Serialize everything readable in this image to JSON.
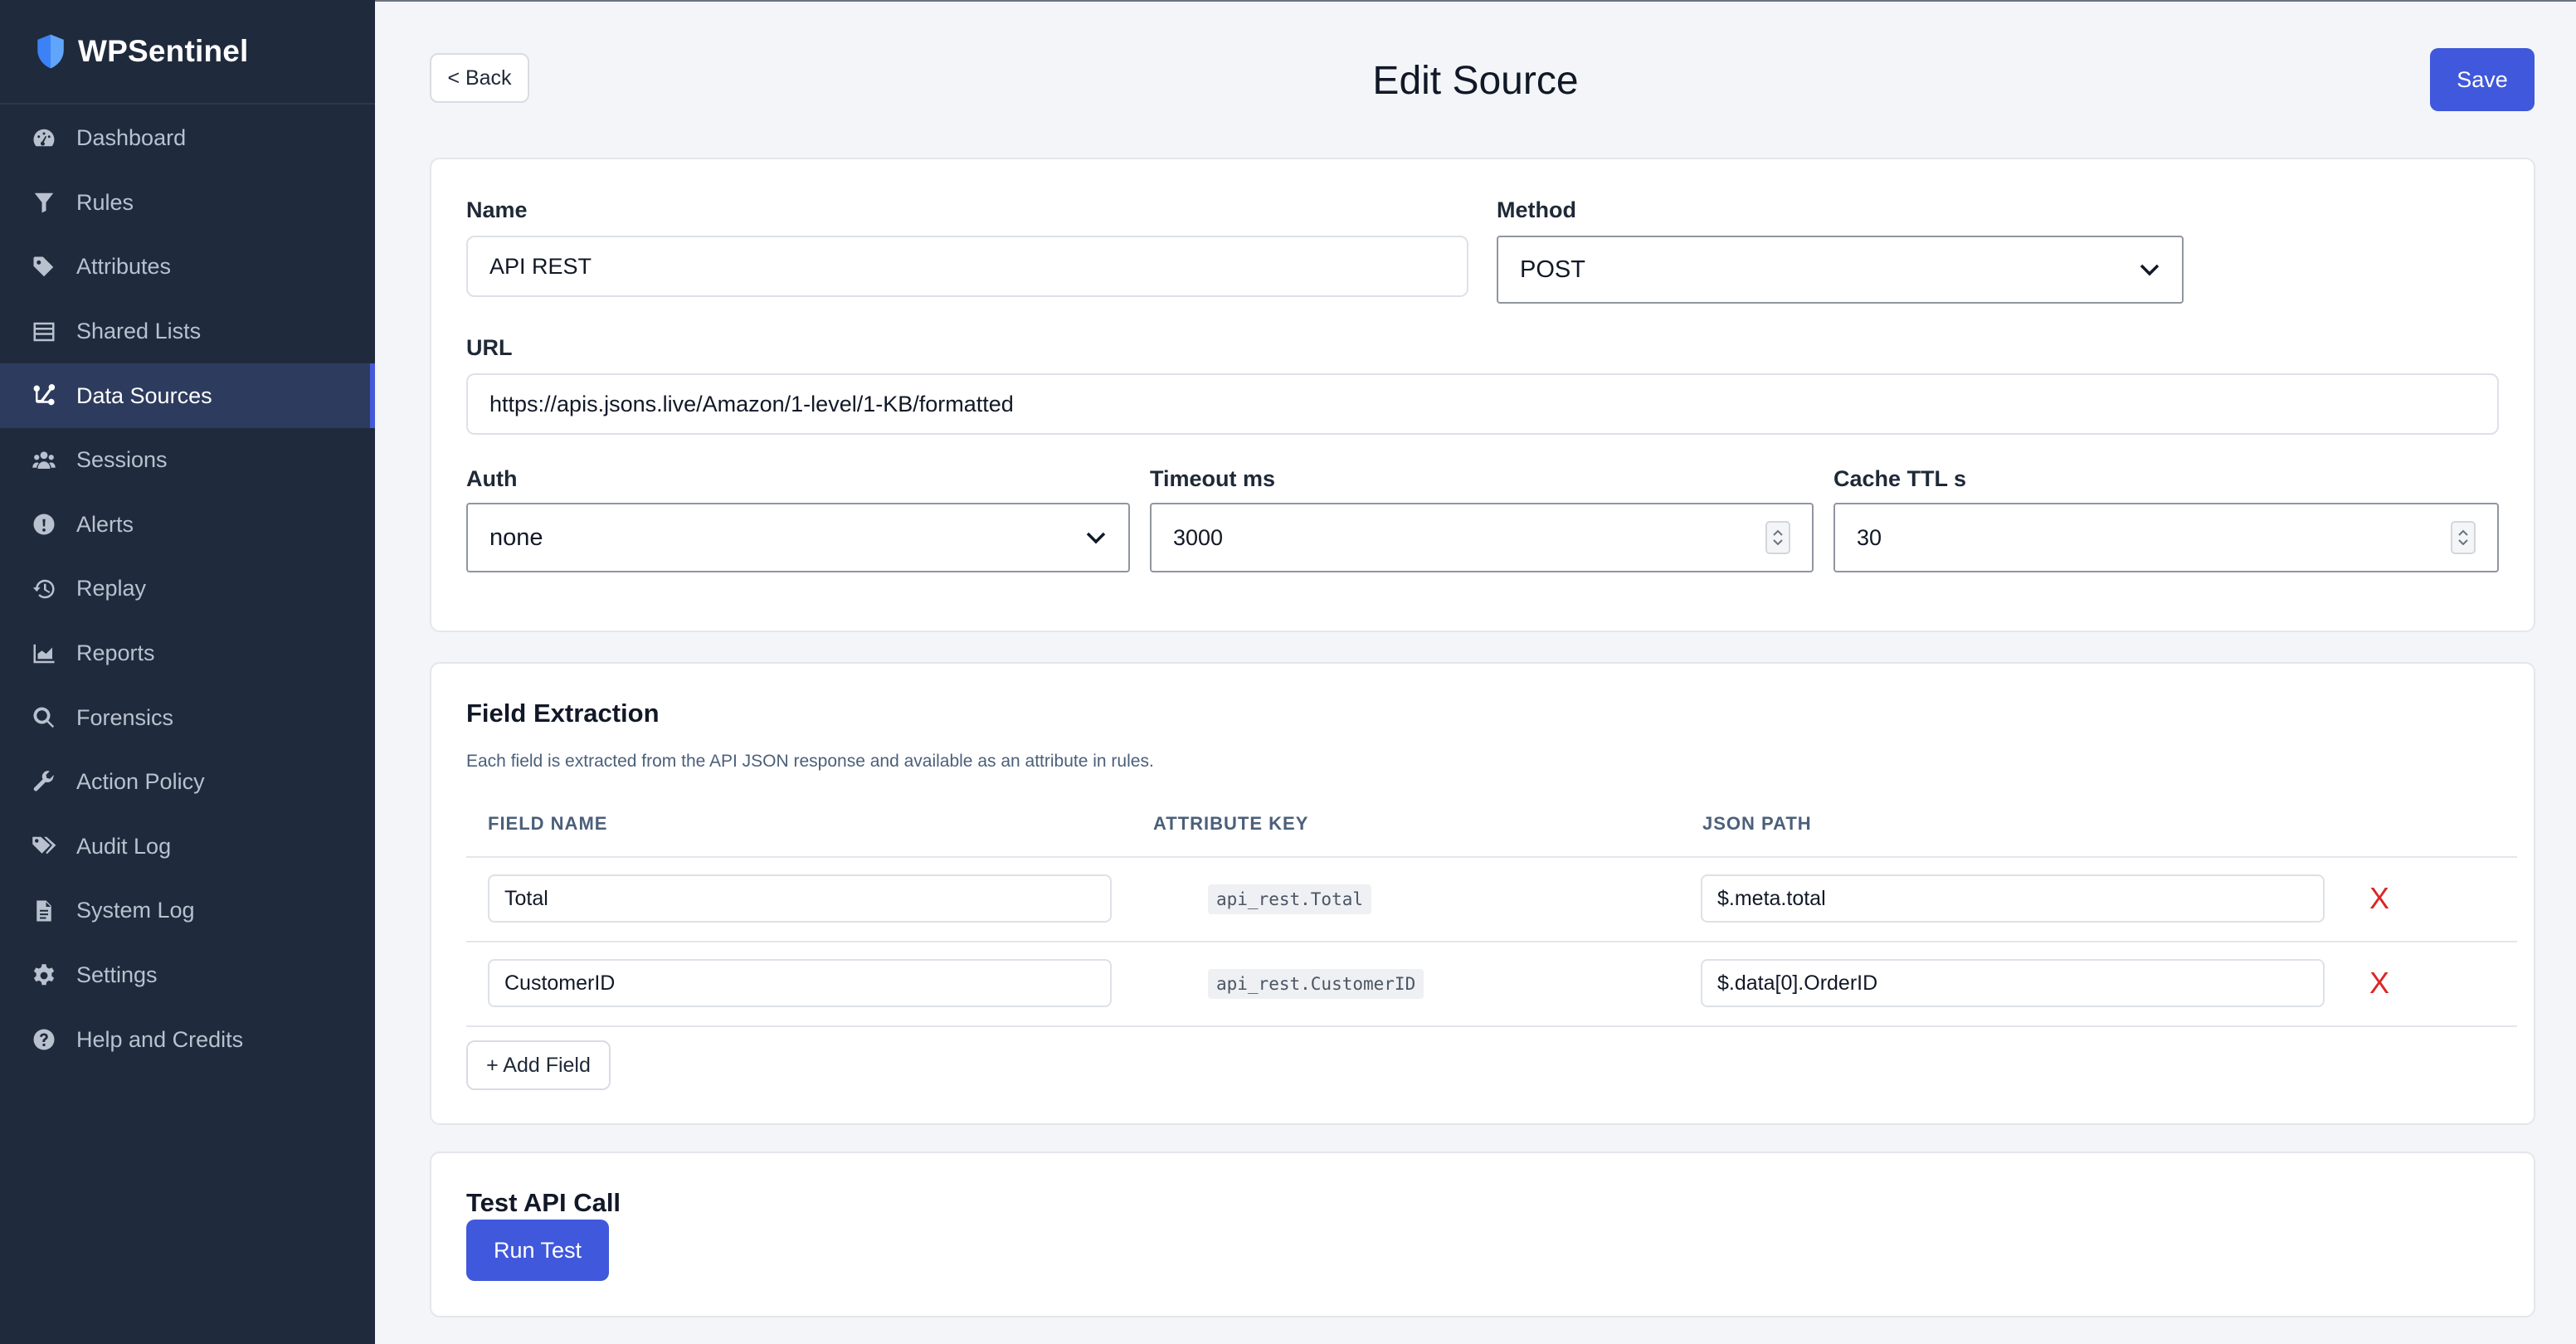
{
  "app": {
    "name": "WPSentinel"
  },
  "sidebar": {
    "items": [
      {
        "label": "Dashboard",
        "icon": "gauge-icon"
      },
      {
        "label": "Rules",
        "icon": "filter-icon"
      },
      {
        "label": "Attributes",
        "icon": "tag-icon"
      },
      {
        "label": "Shared Lists",
        "icon": "list-icon"
      },
      {
        "label": "Data Sources",
        "icon": "connection-icon",
        "active": true
      },
      {
        "label": "Sessions",
        "icon": "users-icon"
      },
      {
        "label": "Alerts",
        "icon": "alert-icon"
      },
      {
        "label": "Replay",
        "icon": "history-icon"
      },
      {
        "label": "Reports",
        "icon": "chart-icon"
      },
      {
        "label": "Forensics",
        "icon": "search-icon"
      },
      {
        "label": "Action Policy",
        "icon": "wrench-icon"
      },
      {
        "label": "Audit Log",
        "icon": "tags-icon"
      },
      {
        "label": "System Log",
        "icon": "file-icon"
      },
      {
        "label": "Settings",
        "icon": "gear-icon"
      },
      {
        "label": "Help and Credits",
        "icon": "help-icon"
      }
    ]
  },
  "header": {
    "back_label": "< Back",
    "title": "Edit Source",
    "save_label": "Save"
  },
  "form": {
    "name_label": "Name",
    "name_value": "API REST",
    "method_label": "Method",
    "method_value": "POST",
    "url_label": "URL",
    "url_value": "https://apis.jsons.live/Amazon/1-level/1-KB/formatted",
    "auth_label": "Auth",
    "auth_value": "none",
    "timeout_label": "Timeout ms",
    "timeout_value": "3000",
    "cache_label": "Cache TTL s",
    "cache_value": "30"
  },
  "extraction": {
    "title": "Field Extraction",
    "helper": "Each field is extracted from the API JSON response and available as an attribute in rules.",
    "columns": [
      "FIELD NAME",
      "ATTRIBUTE KEY",
      "JSON PATH"
    ],
    "rows": [
      {
        "field": "Total",
        "key": "api_rest.Total",
        "path": "$.meta.total",
        "delete": "X"
      },
      {
        "field": "CustomerID",
        "key": "api_rest.CustomerID",
        "path": "$.data[0].OrderID",
        "delete": "X"
      }
    ],
    "add_label": "+ Add Field"
  },
  "test": {
    "title": "Test API Call",
    "run_label": "Run Test"
  },
  "colors": {
    "sidebar_bg": "#1f2a3c",
    "active_bg": "#2d3c5e",
    "accent": "#4058db",
    "danger": "#dc2626"
  }
}
